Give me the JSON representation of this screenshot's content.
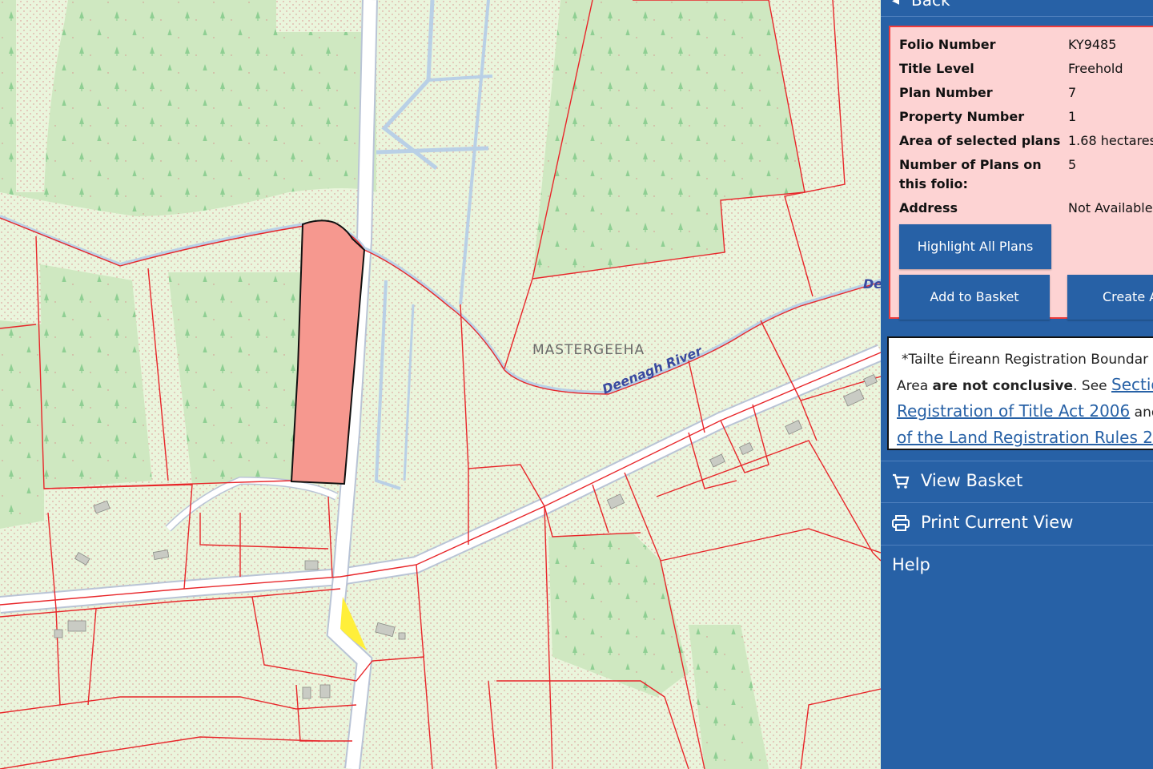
{
  "map": {
    "place_label": "MASTERGEEHA",
    "river_label": "Deenagh River",
    "river_label_edge": "De",
    "colors": {
      "background": "#eaf5dc",
      "woodland": "#cfe8c1",
      "boundary": "#e8262a",
      "road": "#ffffff",
      "road_edge": "#b9c4d6",
      "selected_plot": "#f6988f",
      "highlight": "#ffef3a",
      "river": "#3a4aa0"
    }
  },
  "panel": {
    "back_label": "Back",
    "info": {
      "rows": [
        {
          "key": "Folio Number",
          "value": "KY9485"
        },
        {
          "key": "Title Level",
          "value": "Freehold"
        },
        {
          "key": "Plan Number",
          "value": "7"
        },
        {
          "key": "Property Number",
          "value": "1"
        },
        {
          "key": "Area of selected plans",
          "value": "1.68 hectares"
        },
        {
          "key": "Number of Plans on this folio:",
          "value": "5"
        },
        {
          "key": "Address",
          "value": "Not Available"
        }
      ],
      "buttons": {
        "highlight_all": "Highlight All Plans",
        "add_to_basket": "Add to Basket",
        "create": "Create A"
      }
    },
    "note": {
      "line1": "*Tailte Éireann Registration Boundar",
      "line2_pre": "Area ",
      "line2_bold": "are not conclusive",
      "line2_post": ". See ",
      "line2_link": "Sectio",
      "line3_link": "Registration of Title Act 2006",
      "line3_post": " and",
      "line4_link": "of the Land Registration Rules 2"
    },
    "menu": [
      {
        "label": "View Basket",
        "icon": "cart-icon"
      },
      {
        "label": "Print Current View",
        "icon": "print-icon"
      },
      {
        "label": "Help",
        "icon": ""
      }
    ],
    "colors": {
      "panel": "#2761a6",
      "info_bg": "#fdd3d3",
      "info_border": "#ee3b3b"
    }
  }
}
